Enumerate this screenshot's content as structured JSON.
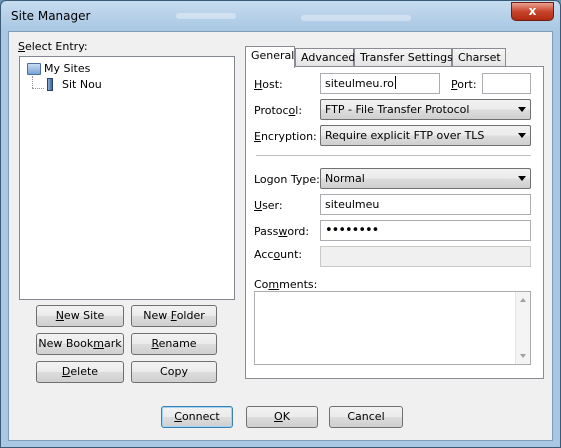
{
  "window": {
    "title": "Site Manager",
    "close_glyph": "x"
  },
  "tree": {
    "label_prefix": "",
    "label_underline": "S",
    "label_rest": "elect Entry:",
    "root": "My Sites",
    "child": "Sit Nou"
  },
  "left_buttons": {
    "new_site_u": "N",
    "new_site_rest": "ew Site",
    "new_folder_pre": "New ",
    "new_folder_u": "F",
    "new_folder_rest": "older",
    "new_bookmark_pre": "New Book",
    "new_bookmark_u": "m",
    "new_bookmark_rest": "ark",
    "rename_u": "R",
    "rename_rest": "ename",
    "delete_u": "D",
    "delete_rest": "elete",
    "copy": "Copy"
  },
  "tabs": [
    "General",
    "Advanced",
    "Transfer Settings",
    "Charset"
  ],
  "general": {
    "host_u": "H",
    "host_rest": "ost:",
    "host_value": "siteulmeu.ro",
    "port_u": "P",
    "port_rest": "ort:",
    "port_value": "",
    "protocol_label_pre": "Protoc",
    "protocol_label_u": "o",
    "protocol_label_rest": "l:",
    "protocol_value": "FTP - File Transfer Protocol",
    "encryption_u": "E",
    "encryption_rest": "ncryption:",
    "encryption_value": "Require explicit FTP over TLS",
    "logon_label_pre": "Logon Type:",
    "logon_value": "Normal",
    "user_u": "U",
    "user_rest": "ser:",
    "user_value": "siteulmeu",
    "password_pre": "Pass",
    "password_u": "w",
    "password_rest": "ord:",
    "password_value": "••••••••",
    "account_pre": "Acc",
    "account_u": "o",
    "account_rest": "unt:",
    "account_value": "",
    "comments_pre": "Co",
    "comments_u": "m",
    "comments_rest": "ments:",
    "comments_value": ""
  },
  "bottom_buttons": {
    "connect_u": "C",
    "connect_rest": "onnect",
    "ok_u": "O",
    "ok_rest": "K",
    "cancel": "Cancel"
  }
}
